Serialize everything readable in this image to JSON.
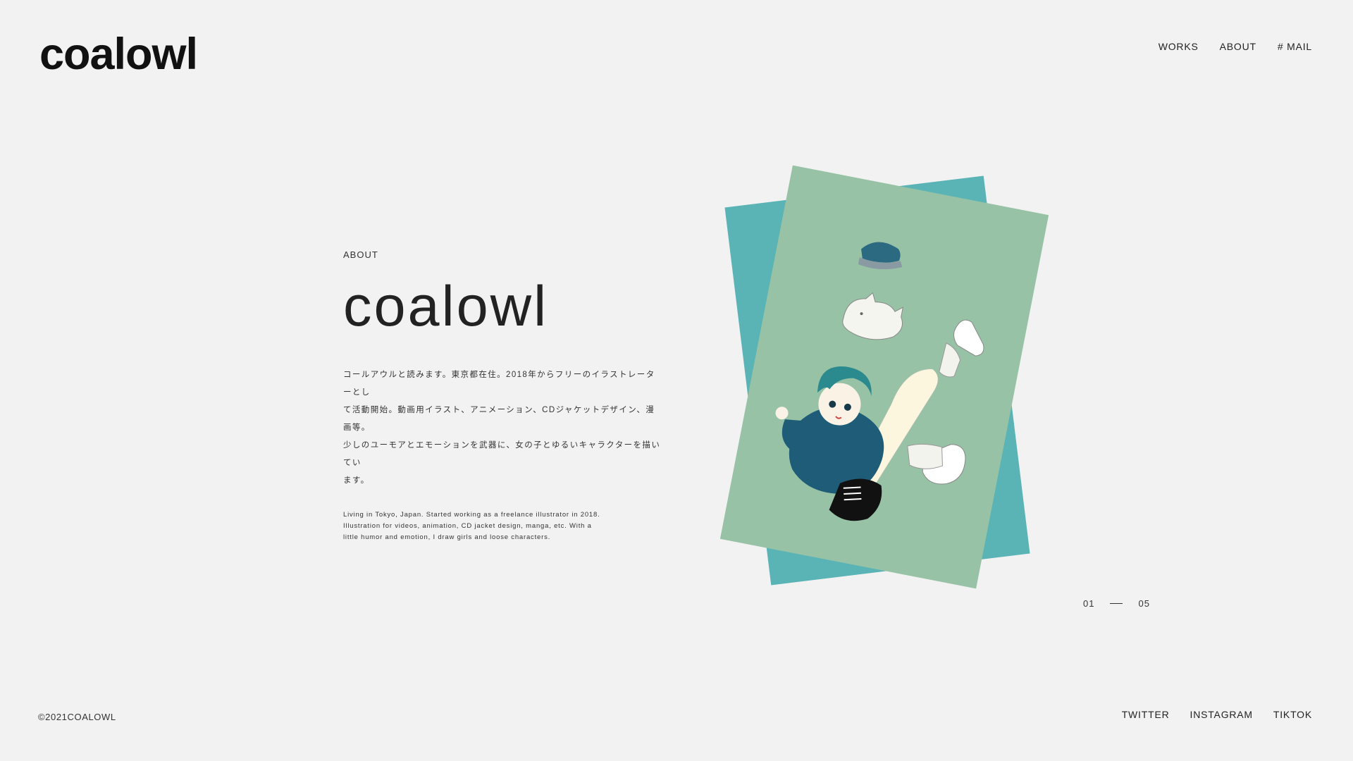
{
  "header": {
    "logo": "coalowl",
    "nav": [
      {
        "label": "WORKS"
      },
      {
        "label": "ABOUT"
      },
      {
        "label": "# MAIL"
      }
    ]
  },
  "about": {
    "eyebrow": "ABOUT",
    "title": "coalowl",
    "jp_lines": [
      "コールアウルと読みます。東京都在住。2018年からフリーのイラストレーターとし",
      "て活動開始。動画用イラスト、アニメーション、CDジャケットデザイン、漫画等。",
      "少しのユーモアとエモーションを武器に、女の子とゆるいキャラクターを描いてい",
      "ます。"
    ],
    "en_lines": [
      "Living in Tokyo, Japan. Started working as a freelance illustrator in 2018.",
      "Illustration for videos, animation, CD jacket design, manga, etc. With a",
      "little humor and emotion, I draw girls and loose characters."
    ]
  },
  "artwork": {
    "back_card_color": "#5ab4b6",
    "front_card_color": "#98c2a6"
  },
  "pager": {
    "current": "01",
    "total": "05"
  },
  "footer": {
    "copyright": "©2021COALOWL",
    "social": [
      {
        "label": "TWITTER"
      },
      {
        "label": "INSTAGRAM"
      },
      {
        "label": "TIKTOK"
      }
    ]
  }
}
